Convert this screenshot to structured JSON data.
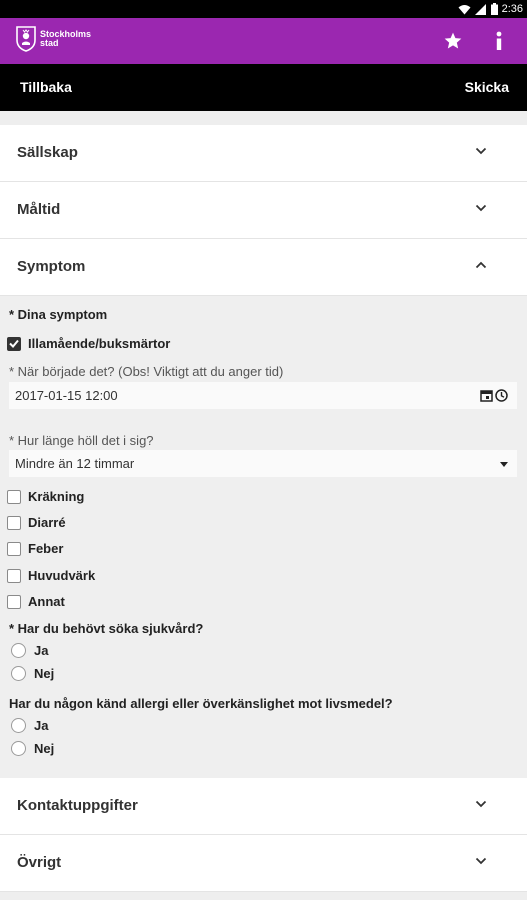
{
  "status_bar": {
    "time": "2:36"
  },
  "app_bar": {
    "logo_text": "Stockholms\nstad"
  },
  "nav": {
    "back_label": "Tillbaka",
    "send_label": "Skicka"
  },
  "sections_top": [
    {
      "label": "Sällskap"
    },
    {
      "label": "Måltid"
    },
    {
      "label": "Symptom"
    }
  ],
  "symptom_form": {
    "symptoms_label": "* Dina symptom",
    "main_checkbox": {
      "label": "Illamående/buksmärtor",
      "checked": true
    },
    "start_label": "* När började det? (Obs! Viktigt att du anger tid)",
    "start_value": "2017-01-15 12:00",
    "duration_label": "* Hur länge höll det i sig?",
    "duration_value": "Mindre än 12 timmar",
    "other_checkboxes": [
      {
        "label": "Kräkning",
        "checked": false
      },
      {
        "label": "Diarré",
        "checked": false
      },
      {
        "label": "Feber",
        "checked": false
      },
      {
        "label": "Huvudvärk",
        "checked": false
      },
      {
        "label": "Annat",
        "checked": false
      }
    ],
    "care_question": "* Har du behövt söka sjukvård?",
    "care_options": [
      "Ja",
      "Nej"
    ],
    "allergy_question": "Har du någon känd allergi eller överkänslighet mot livsmedel?",
    "allergy_options": [
      "Ja",
      "Nej"
    ]
  },
  "sections_bottom": [
    {
      "label": "Kontaktuppgifter"
    },
    {
      "label": "Övrigt"
    }
  ],
  "colors": {
    "app_bar": "#9b27b0",
    "nav_bar": "#000000",
    "panel": "#efefef"
  }
}
